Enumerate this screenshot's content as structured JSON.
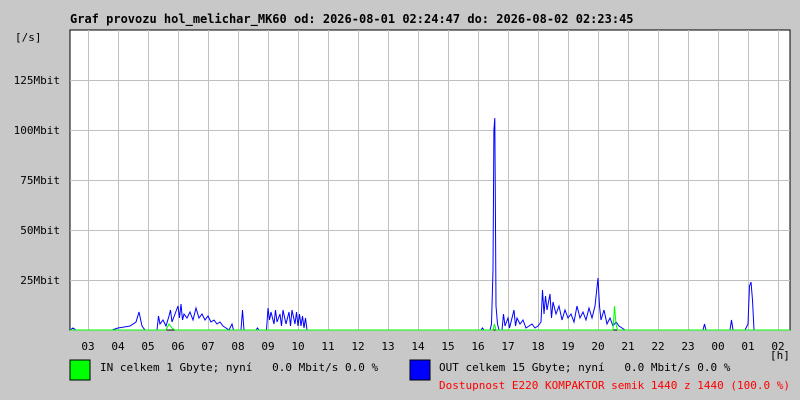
{
  "chart_data": {
    "type": "line",
    "title": "Graf provozu hol_melichar_MK60 od: 2026-08-01 02:24:47 do: 2026-08-02 02:23:45",
    "ylabel": "[/s]",
    "xlabel": "[h]",
    "ylim": [
      0,
      150
    ],
    "y_ticks": [
      {
        "value": 25,
        "label": "25Mbit"
      },
      {
        "value": 50,
        "label": "50Mbit"
      },
      {
        "value": 75,
        "label": "75Mbit"
      },
      {
        "value": 100,
        "label": "100Mbit"
      },
      {
        "value": 125,
        "label": "125Mbit"
      }
    ],
    "x_ticks": [
      {
        "value": 3,
        "label": "03"
      },
      {
        "value": 4,
        "label": "04"
      },
      {
        "value": 5,
        "label": "05"
      },
      {
        "value": 6,
        "label": "06"
      },
      {
        "value": 7,
        "label": "07"
      },
      {
        "value": 8,
        "label": "08"
      },
      {
        "value": 9,
        "label": "09"
      },
      {
        "value": 10,
        "label": "10"
      },
      {
        "value": 11,
        "label": "11"
      },
      {
        "value": 12,
        "label": "12"
      },
      {
        "value": 13,
        "label": "13"
      },
      {
        "value": 14,
        "label": "14"
      },
      {
        "value": 15,
        "label": "15"
      },
      {
        "value": 16,
        "label": "16"
      },
      {
        "value": 17,
        "label": "17"
      },
      {
        "value": 18,
        "label": "18"
      },
      {
        "value": 19,
        "label": "19"
      },
      {
        "value": 20,
        "label": "20"
      },
      {
        "value": 21,
        "label": "21"
      },
      {
        "value": 22,
        "label": "22"
      },
      {
        "value": 23,
        "label": "23"
      },
      {
        "value": 24,
        "label": "00"
      },
      {
        "value": 25,
        "label": "01"
      },
      {
        "value": 26,
        "label": "02"
      }
    ],
    "xlim": [
      2.4,
      26.4
    ],
    "grid": true,
    "series": [
      {
        "name": "OUT",
        "color": "#0000ff",
        "points": [
          [
            2.4,
            0
          ],
          [
            2.5,
            1
          ],
          [
            2.6,
            0
          ],
          [
            3.8,
            0
          ],
          [
            4.0,
            1
          ],
          [
            4.4,
            2
          ],
          [
            4.6,
            4
          ],
          [
            4.7,
            9
          ],
          [
            4.8,
            2
          ],
          [
            4.9,
            0
          ],
          [
            5.3,
            0
          ],
          [
            5.35,
            7
          ],
          [
            5.4,
            3
          ],
          [
            5.5,
            5
          ],
          [
            5.6,
            2
          ],
          [
            5.7,
            7
          ],
          [
            5.75,
            10
          ],
          [
            5.8,
            4
          ],
          [
            5.9,
            8
          ],
          [
            6.0,
            12
          ],
          [
            6.05,
            6
          ],
          [
            6.1,
            13
          ],
          [
            6.15,
            5
          ],
          [
            6.2,
            8
          ],
          [
            6.3,
            6
          ],
          [
            6.4,
            9
          ],
          [
            6.5,
            5
          ],
          [
            6.6,
            11
          ],
          [
            6.7,
            6
          ],
          [
            6.8,
            8
          ],
          [
            6.9,
            5
          ],
          [
            7.0,
            7
          ],
          [
            7.1,
            4
          ],
          [
            7.2,
            5
          ],
          [
            7.3,
            3
          ],
          [
            7.4,
            4
          ],
          [
            7.5,
            2
          ],
          [
            7.6,
            1
          ],
          [
            7.7,
            0
          ],
          [
            7.8,
            3
          ],
          [
            7.85,
            0
          ],
          [
            8.1,
            0
          ],
          [
            8.15,
            10
          ],
          [
            8.2,
            0
          ],
          [
            8.6,
            0
          ],
          [
            8.65,
            1
          ],
          [
            8.7,
            0
          ],
          [
            8.95,
            0
          ],
          [
            9.0,
            11
          ],
          [
            9.05,
            5
          ],
          [
            9.1,
            9
          ],
          [
            9.2,
            3
          ],
          [
            9.25,
            10
          ],
          [
            9.3,
            4
          ],
          [
            9.4,
            8
          ],
          [
            9.45,
            2
          ],
          [
            9.5,
            10
          ],
          [
            9.6,
            3
          ],
          [
            9.7,
            9
          ],
          [
            9.75,
            2
          ],
          [
            9.8,
            10
          ],
          [
            9.9,
            3
          ],
          [
            9.95,
            9
          ],
          [
            10.0,
            2
          ],
          [
            10.05,
            8
          ],
          [
            10.1,
            2
          ],
          [
            10.15,
            7
          ],
          [
            10.2,
            1
          ],
          [
            10.25,
            6
          ],
          [
            10.3,
            0
          ],
          [
            16.1,
            0
          ],
          [
            16.15,
            1
          ],
          [
            16.2,
            0
          ],
          [
            16.4,
            0
          ],
          [
            16.45,
            3
          ],
          [
            16.5,
            30
          ],
          [
            16.53,
            100
          ],
          [
            16.56,
            106
          ],
          [
            16.58,
            60
          ],
          [
            16.6,
            12
          ],
          [
            16.65,
            3
          ],
          [
            16.7,
            0
          ],
          [
            16.8,
            0
          ],
          [
            16.85,
            8
          ],
          [
            16.9,
            2
          ],
          [
            17.0,
            6
          ],
          [
            17.05,
            1
          ],
          [
            17.2,
            10
          ],
          [
            17.25,
            2
          ],
          [
            17.3,
            6
          ],
          [
            17.4,
            3
          ],
          [
            17.5,
            5
          ],
          [
            17.6,
            1
          ],
          [
            17.8,
            3
          ],
          [
            17.9,
            1
          ],
          [
            18.0,
            2
          ],
          [
            18.1,
            4
          ],
          [
            18.15,
            20
          ],
          [
            18.2,
            8
          ],
          [
            18.25,
            17
          ],
          [
            18.3,
            10
          ],
          [
            18.4,
            18
          ],
          [
            18.45,
            6
          ],
          [
            18.5,
            14
          ],
          [
            18.6,
            8
          ],
          [
            18.7,
            12
          ],
          [
            18.8,
            5
          ],
          [
            18.9,
            10
          ],
          [
            19.0,
            6
          ],
          [
            19.1,
            8
          ],
          [
            19.2,
            4
          ],
          [
            19.3,
            12
          ],
          [
            19.4,
            6
          ],
          [
            19.5,
            9
          ],
          [
            19.6,
            5
          ],
          [
            19.7,
            11
          ],
          [
            19.8,
            6
          ],
          [
            19.9,
            12
          ],
          [
            20.0,
            26
          ],
          [
            20.05,
            12
          ],
          [
            20.1,
            5
          ],
          [
            20.2,
            10
          ],
          [
            20.3,
            3
          ],
          [
            20.4,
            6
          ],
          [
            20.5,
            2
          ],
          [
            20.6,
            4
          ],
          [
            20.7,
            2
          ],
          [
            20.8,
            1
          ],
          [
            20.9,
            0
          ],
          [
            23.5,
            0
          ],
          [
            23.55,
            3
          ],
          [
            23.6,
            0
          ],
          [
            24.4,
            0
          ],
          [
            24.45,
            5
          ],
          [
            24.5,
            0
          ],
          [
            24.9,
            0
          ],
          [
            25.0,
            3
          ],
          [
            25.05,
            22
          ],
          [
            25.1,
            24
          ],
          [
            25.15,
            15
          ],
          [
            25.2,
            0
          ],
          [
            26.4,
            0
          ]
        ]
      },
      {
        "name": "IN",
        "color": "#00ff00",
        "points": [
          [
            2.4,
            0
          ],
          [
            5.6,
            0
          ],
          [
            5.7,
            3
          ],
          [
            5.8,
            1
          ],
          [
            5.9,
            0
          ],
          [
            16.5,
            0
          ],
          [
            16.55,
            3
          ],
          [
            16.6,
            0
          ],
          [
            20.5,
            0
          ],
          [
            20.55,
            12
          ],
          [
            20.6,
            3
          ],
          [
            20.65,
            0
          ],
          [
            26.4,
            0
          ]
        ]
      }
    ]
  },
  "legend": {
    "in_text": "IN celkem 1 Gbyte; nyní   0.0 Mbit/s 0.0 %",
    "in_color": "#00ff00",
    "out_text": "OUT celkem 15 Gbyte; nyní   0.0 Mbit/s 0.0 %",
    "out_color": "#0000ff",
    "availability": "Dostupnost E220 KOMPAKTOR semik 1440 z 1440 (100.0 %)",
    "availability_color": "#ff0000"
  }
}
